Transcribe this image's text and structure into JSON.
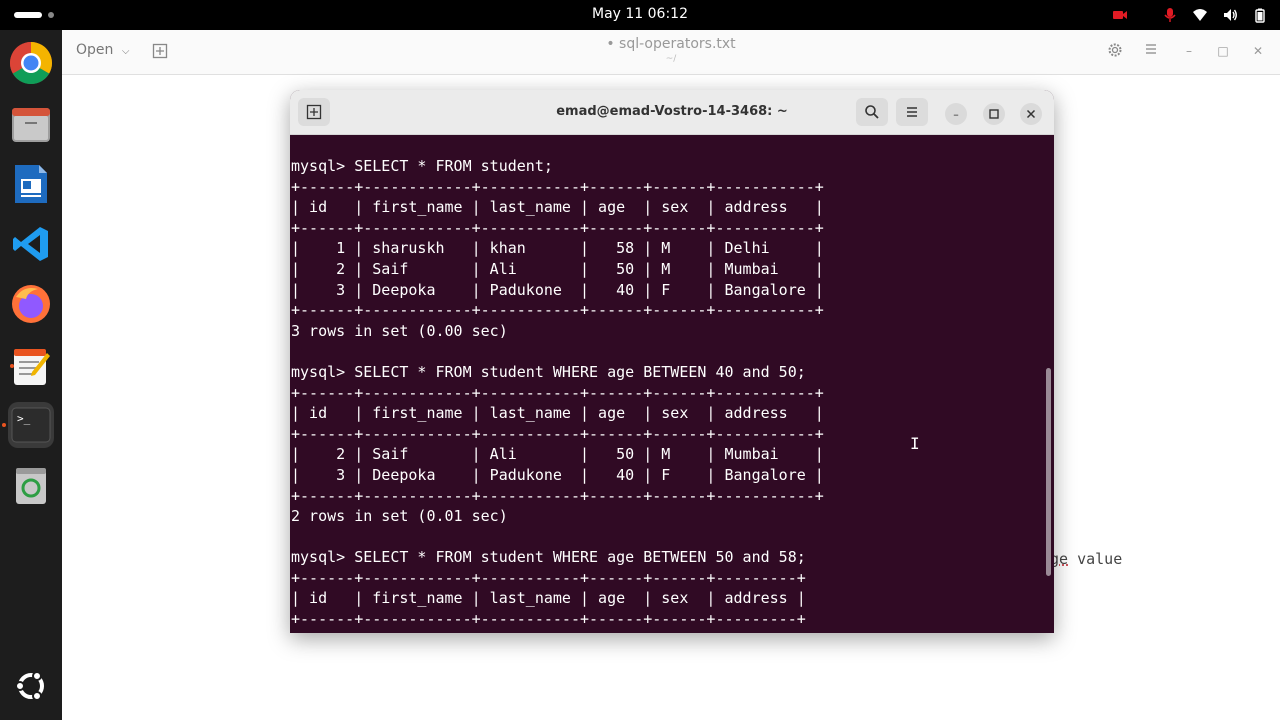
{
  "topbar": {
    "clock": "May 11  06:12"
  },
  "dock": {
    "items": [
      "chrome-icon",
      "files-icon",
      "writer-icon",
      "vscode-icon",
      "firefox-icon",
      "text-editor-icon",
      "terminal-icon",
      "trash-icon",
      "ubuntu-apps-icon"
    ]
  },
  "gedit": {
    "open_label": "Open",
    "title": "• sql-operators.txt",
    "subtitle": "~/",
    "background_text_a": "ge",
    "background_text_b": " value"
  },
  "terminal": {
    "title": "emad@emad-Vostro-14-3468: ~",
    "lines": [
      "mysql> SELECT * FROM student;",
      "+------+------------+-----------+------+------+-----------+",
      "| id   | first_name | last_name | age  | sex  | address   |",
      "+------+------------+-----------+------+------+-----------+",
      "|    1 | sharuskh   | khan      |   58 | M    | Delhi     |",
      "|    2 | Saif       | Ali       |   50 | M    | Mumbai    |",
      "|    3 | Deepoka    | Padukone  |   40 | F    | Bangalore |",
      "+------+------------+-----------+------+------+-----------+",
      "3 rows in set (0.00 sec)",
      "",
      "mysql> SELECT * FROM student WHERE age BETWEEN 40 and 50;",
      "+------+------------+-----------+------+------+-----------+",
      "| id   | first_name | last_name | age  | sex  | address   |",
      "+------+------------+-----------+------+------+-----------+",
      "|    2 | Saif       | Ali       |   50 | M    | Mumbai    |",
      "|    3 | Deepoka    | Padukone  |   40 | F    | Bangalore |",
      "+------+------------+-----------+------+------+-----------+",
      "2 rows in set (0.01 sec)",
      "",
      "mysql> SELECT * FROM student WHERE age BETWEEN 50 and 58;",
      "+------+------------+-----------+------+------+---------+",
      "| id   | first_name | last_name | age  | sex  | address |",
      "+------+------------+-----------+------+------+---------+"
    ]
  },
  "colors": {
    "terminal_bg": "#300a24",
    "accent": "#e95420"
  }
}
